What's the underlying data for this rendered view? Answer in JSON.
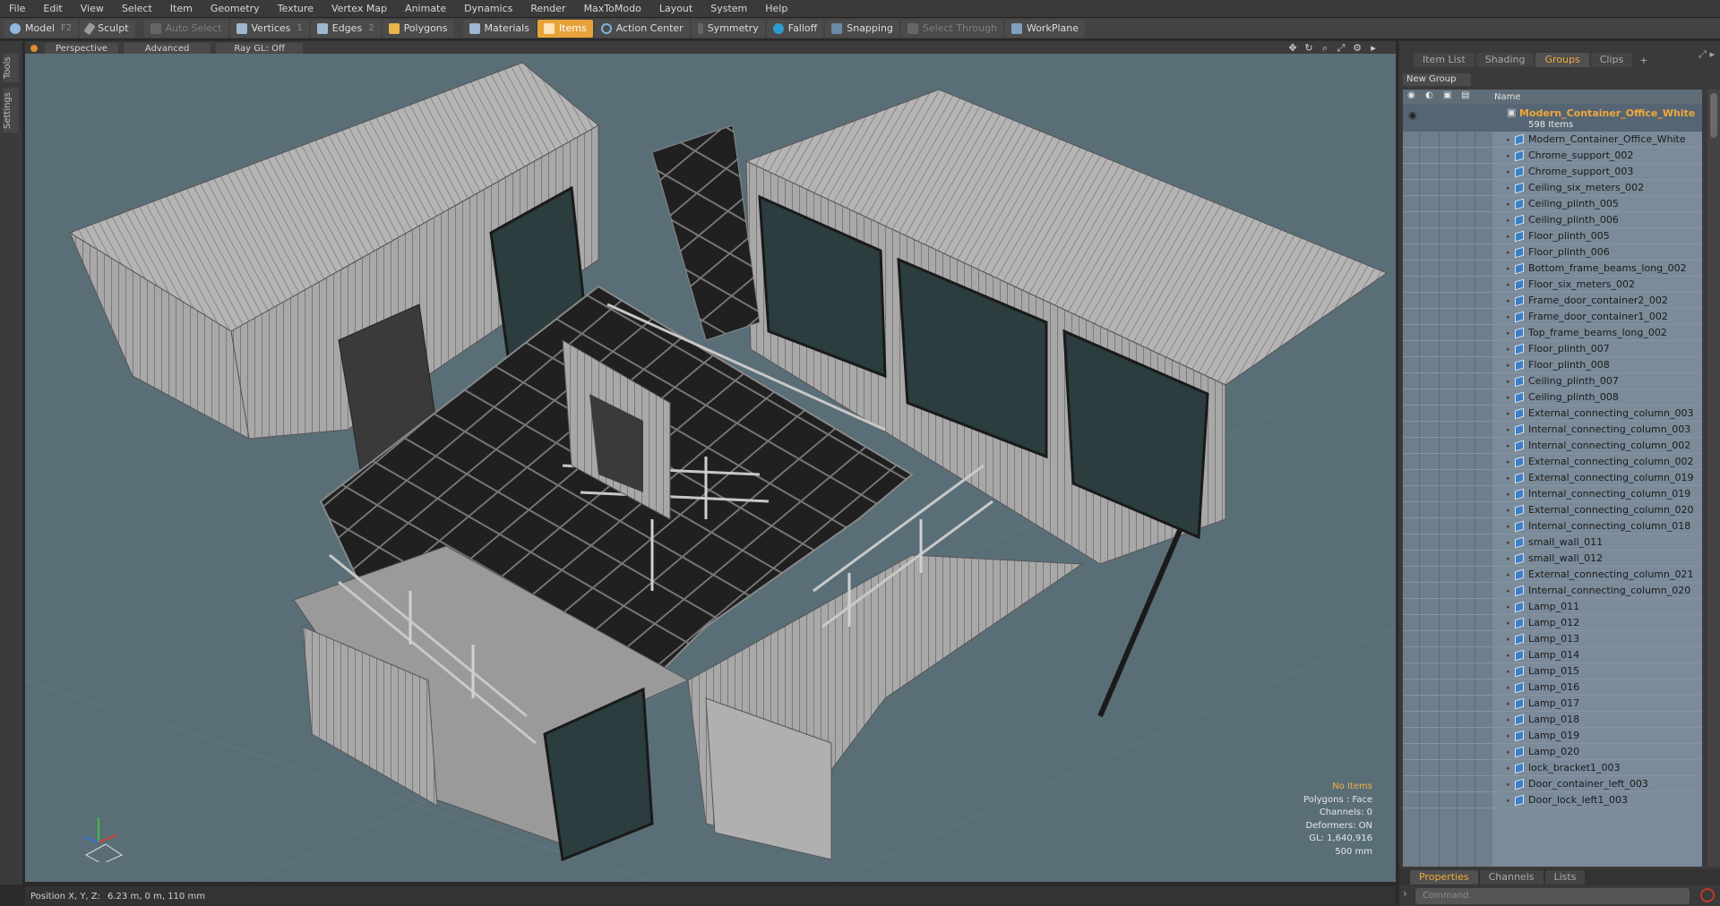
{
  "menu": [
    "File",
    "Edit",
    "View",
    "Select",
    "Item",
    "Geometry",
    "Texture",
    "Vertex Map",
    "Animate",
    "Dynamics",
    "Render",
    "MaxToModo",
    "Layout",
    "System",
    "Help"
  ],
  "toolbar": {
    "model": "Model",
    "model_key": "F2",
    "sculpt": "Sculpt",
    "auto_select": "Auto Select",
    "vertices": "Vertices",
    "vertices_key": "1",
    "edges": "Edges",
    "edges_key": "2",
    "polygons": "Polygons",
    "materials": "Materials",
    "items": "Items",
    "action_center": "Action Center",
    "symmetry": "Symmetry",
    "falloff": "Falloff",
    "snapping": "Snapping",
    "select_through": "Select Through",
    "workplane": "WorkPlane"
  },
  "left_tabs": {
    "tools": "Tools",
    "settings": "Settings"
  },
  "viewport": {
    "view": "Perspective",
    "shading": "Advanced",
    "raygl": "Ray GL: Off",
    "hud": {
      "items": "No Items",
      "polygons": "Polygons : Face",
      "channels": "Channels: 0",
      "deformers": "Deformers: ON",
      "gl": "GL: 1,640,916",
      "scale": "500 mm"
    }
  },
  "status": {
    "label": "Position X, Y, Z:",
    "value": "6.23 m, 0 m, 110 mm"
  },
  "panel": {
    "tabs": [
      "Item List",
      "Shading",
      "Groups",
      "Clips"
    ],
    "active_tab": "Groups",
    "new_group": "New Group",
    "name_header": "Name",
    "group_title": "Modern_Container_Office_White",
    "group_count": "598 Items",
    "items": [
      "Modern_Container_Office_White",
      "Chrome_support_002",
      "Chrome_support_003",
      "Ceiling_six_meters_002",
      "Ceiling_plinth_005",
      "Ceiling_plinth_006",
      "Floor_plinth_005",
      "Floor_plinth_006",
      "Bottom_frame_beams_long_002",
      "Floor_six_meters_002",
      "Frame_door_container2_002",
      "Frame_door_container1_002",
      "Top_frame_beams_long_002",
      "Floor_plinth_007",
      "Floor_plinth_008",
      "Ceiling_plinth_007",
      "Ceiling_plinth_008",
      "External_connecting_column_003",
      "Internal_connecting_column_003",
      "Internal_connecting_column_002",
      "External_connecting_column_002",
      "External_connecting_column_019",
      "Internal_connecting_column_019",
      "External_connecting_column_020",
      "Internal_connecting_column_018",
      "small_wall_011",
      "small_wall_012",
      "External_connecting_column_021",
      "Internal_connecting_column_020",
      "Lamp_011",
      "Lamp_012",
      "Lamp_013",
      "Lamp_014",
      "Lamp_015",
      "Lamp_016",
      "Lamp_017",
      "Lamp_018",
      "Lamp_019",
      "Lamp_020",
      "lock_bracket1_003",
      "Door_container_left_003",
      "Door_lock_left1_003"
    ],
    "bottom_tabs": [
      "Properties",
      "Channels",
      "Lists"
    ],
    "bottom_active": "Properties",
    "command_placeholder": "Command"
  },
  "colors": {
    "accent": "#f0a93a",
    "viewport_bg": "#5a6e78",
    "list_bg": "#7b8b99"
  }
}
